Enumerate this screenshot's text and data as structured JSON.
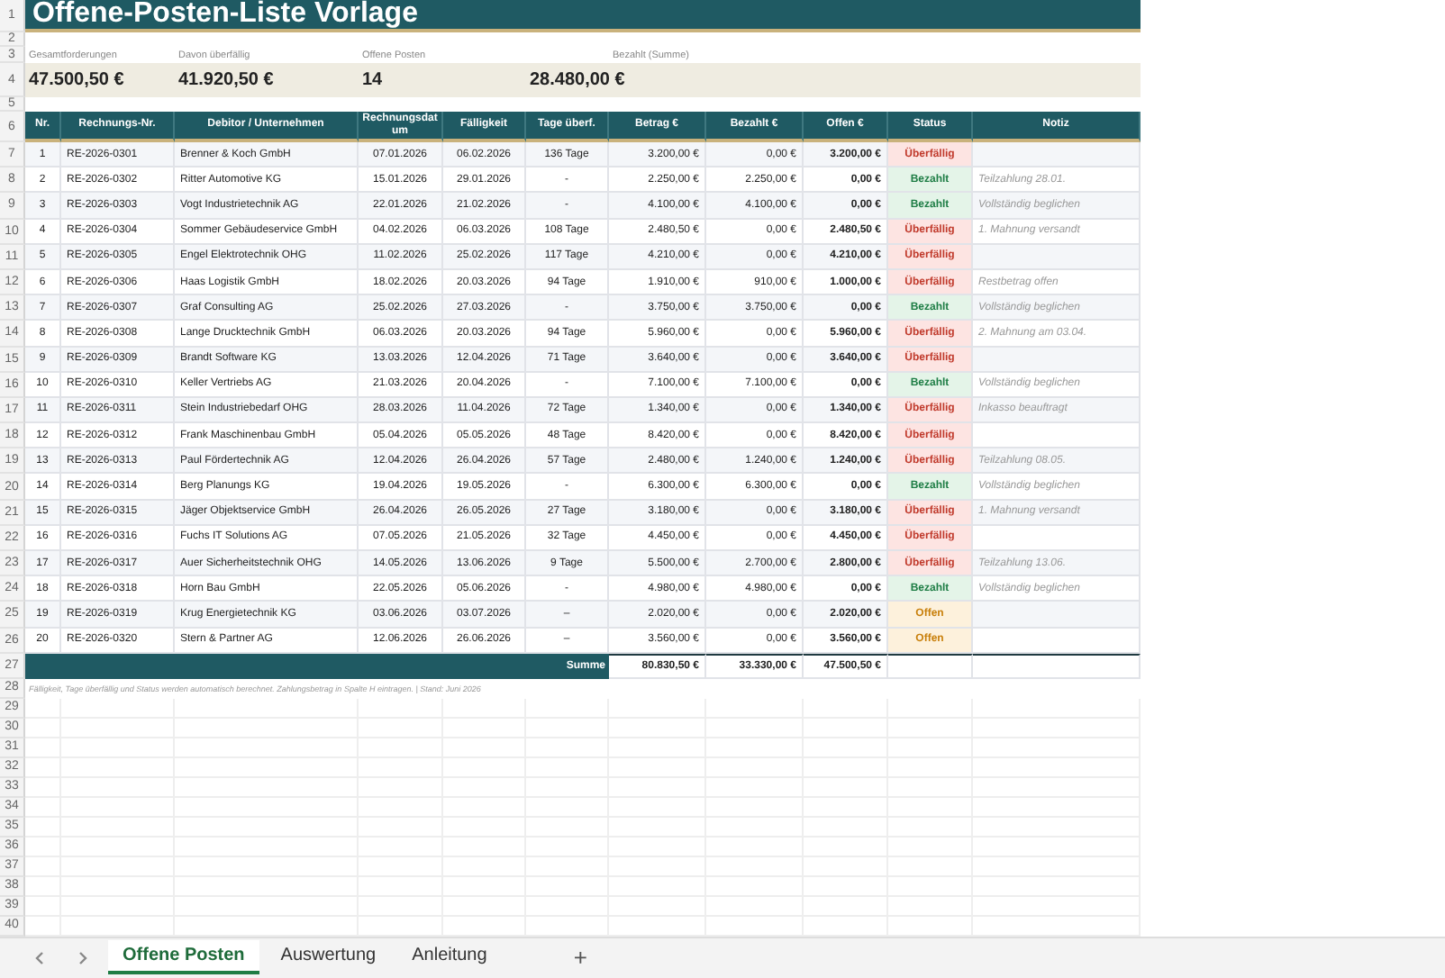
{
  "title": "Offene-Posten-Liste Vorlage",
  "row_numbers": [
    "1",
    "2",
    "3",
    "4",
    "5",
    "6",
    "7",
    "8",
    "9",
    "10",
    "11",
    "12",
    "13",
    "14",
    "15",
    "16",
    "17",
    "18",
    "19",
    "20",
    "21",
    "22",
    "23",
    "24",
    "25",
    "26",
    "27",
    "28",
    "29",
    "30",
    "31",
    "32",
    "33",
    "34",
    "35",
    "36",
    "37",
    "38",
    "39",
    "40"
  ],
  "summary": [
    {
      "label": "Gesamtforderungen",
      "value": "47.500,50 €"
    },
    {
      "label": "Davon überfällig",
      "value": "41.920,50 €"
    },
    {
      "label": "Offene Posten",
      "value": "14"
    },
    {
      "label": "Bezahlt (Summe)",
      "value": "28.480,00 €"
    }
  ],
  "columns": [
    "Nr.",
    "Rechnungs-Nr.",
    "Debitor / Unternehmen",
    "Rechnungsdatum",
    "Fälligkeit",
    "Tage überf.",
    "Betrag €",
    "Bezahlt €",
    "Offen €",
    "Status",
    "Notiz"
  ],
  "rows": [
    {
      "nr": "1",
      "invoice": "RE-2026-0301",
      "debtor": "Brenner & Koch GmbH",
      "date": "07.01.2026",
      "due": "06.02.2026",
      "overdue": "136 Tage",
      "amount": "3.200,00 €",
      "paid": "0,00 €",
      "open": "3.200,00 €",
      "status": "Überfällig",
      "kind": "overdue"
    },
    {
      "nr": "2",
      "invoice": "RE-2026-0302",
      "debtor": "Ritter Automotive KG",
      "date": "15.01.2026",
      "due": "29.01.2026",
      "overdue": "-",
      "amount": "2.250,00 €",
      "paid": "2.250,00 €",
      "open": "0,00 €",
      "status": "Bezahlt",
      "kind": "paid",
      "note": "Teilzahlung 28.01."
    },
    {
      "nr": "3",
      "invoice": "RE-2026-0303",
      "debtor": "Vogt Industrietechnik AG",
      "date": "22.01.2026",
      "due": "21.02.2026",
      "overdue": "-",
      "amount": "4.100,00 €",
      "paid": "4.100,00 €",
      "open": "0,00 €",
      "status": "Bezahlt",
      "kind": "paid",
      "note": "Vollständig beglichen"
    },
    {
      "nr": "4",
      "invoice": "RE-2026-0304",
      "debtor": "Sommer Gebäudeservice GmbH",
      "date": "04.02.2026",
      "due": "06.03.2026",
      "overdue": "108 Tage",
      "amount": "2.480,50 €",
      "paid": "0,00 €",
      "open": "2.480,50 €",
      "status": "Überfällig",
      "kind": "overdue",
      "note": "1. Mahnung versandt"
    },
    {
      "nr": "5",
      "invoice": "RE-2026-0305",
      "debtor": "Engel Elektrotechnik OHG",
      "date": "11.02.2026",
      "due": "25.02.2026",
      "overdue": "117 Tage",
      "amount": "4.210,00 €",
      "paid": "0,00 €",
      "open": "4.210,00 €",
      "status": "Überfällig",
      "kind": "overdue"
    },
    {
      "nr": "6",
      "invoice": "RE-2026-0306",
      "debtor": "Haas Logistik GmbH",
      "date": "18.02.2026",
      "due": "20.03.2026",
      "overdue": "94 Tage",
      "amount": "1.910,00 €",
      "paid": "910,00 €",
      "open": "1.000,00 €",
      "status": "Überfällig",
      "kind": "overdue",
      "note": "Restbetrag offen"
    },
    {
      "nr": "7",
      "invoice": "RE-2026-0307",
      "debtor": "Graf Consulting AG",
      "date": "25.02.2026",
      "due": "27.03.2026",
      "overdue": "-",
      "amount": "3.750,00 €",
      "paid": "3.750,00 €",
      "open": "0,00 €",
      "status": "Bezahlt",
      "kind": "paid",
      "note": "Vollständig beglichen"
    },
    {
      "nr": "8",
      "invoice": "RE-2026-0308",
      "debtor": "Lange Drucktechnik GmbH",
      "date": "06.03.2026",
      "due": "20.03.2026",
      "overdue": "94 Tage",
      "amount": "5.960,00 €",
      "paid": "0,00 €",
      "open": "5.960,00 €",
      "status": "Überfällig",
      "kind": "overdue",
      "note": "2. Mahnung am 03.04."
    },
    {
      "nr": "9",
      "invoice": "RE-2026-0309",
      "debtor": "Brandt Software KG",
      "date": "13.03.2026",
      "due": "12.04.2026",
      "overdue": "71 Tage",
      "amount": "3.640,00 €",
      "paid": "0,00 €",
      "open": "3.640,00 €",
      "status": "Überfällig",
      "kind": "overdue"
    },
    {
      "nr": "10",
      "invoice": "RE-2026-0310",
      "debtor": "Keller Vertriebs AG",
      "date": "21.03.2026",
      "due": "20.04.2026",
      "overdue": "-",
      "amount": "7.100,00 €",
      "paid": "7.100,00 €",
      "open": "0,00 €",
      "status": "Bezahlt",
      "kind": "paid",
      "note": "Vollständig beglichen"
    },
    {
      "nr": "11",
      "invoice": "RE-2026-0311",
      "debtor": "Stein Industriebedarf OHG",
      "date": "28.03.2026",
      "due": "11.04.2026",
      "overdue": "72 Tage",
      "amount": "1.340,00 €",
      "paid": "0,00 €",
      "open": "1.340,00 €",
      "status": "Überfällig",
      "kind": "overdue",
      "note": "Inkasso beauftragt"
    },
    {
      "nr": "12",
      "invoice": "RE-2026-0312",
      "debtor": "Frank Maschinenbau GmbH",
      "date": "05.04.2026",
      "due": "05.05.2026",
      "overdue": "48 Tage",
      "amount": "8.420,00 €",
      "paid": "0,00 €",
      "open": "8.420,00 €",
      "status": "Überfällig",
      "kind": "overdue"
    },
    {
      "nr": "13",
      "invoice": "RE-2026-0313",
      "debtor": "Paul Fördertechnik AG",
      "date": "12.04.2026",
      "due": "26.04.2026",
      "overdue": "57 Tage",
      "amount": "2.480,00 €",
      "paid": "1.240,00 €",
      "open": "1.240,00 €",
      "status": "Überfällig",
      "kind": "overdue",
      "note": "Teilzahlung 08.05."
    },
    {
      "nr": "14",
      "invoice": "RE-2026-0314",
      "debtor": "Berg Planungs KG",
      "date": "19.04.2026",
      "due": "19.05.2026",
      "overdue": "-",
      "amount": "6.300,00 €",
      "paid": "6.300,00 €",
      "open": "0,00 €",
      "status": "Bezahlt",
      "kind": "paid",
      "note": "Vollständig beglichen"
    },
    {
      "nr": "15",
      "invoice": "RE-2026-0315",
      "debtor": "Jäger Objektservice GmbH",
      "date": "26.04.2026",
      "due": "26.05.2026",
      "overdue": "27 Tage",
      "amount": "3.180,00 €",
      "paid": "0,00 €",
      "open": "3.180,00 €",
      "status": "Überfällig",
      "kind": "overdue",
      "note": "1. Mahnung versandt"
    },
    {
      "nr": "16",
      "invoice": "RE-2026-0316",
      "debtor": "Fuchs IT Solutions AG",
      "date": "07.05.2026",
      "due": "21.05.2026",
      "overdue": "32 Tage",
      "amount": "4.450,00 €",
      "paid": "0,00 €",
      "open": "4.450,00 €",
      "status": "Überfällig",
      "kind": "overdue"
    },
    {
      "nr": "17",
      "invoice": "RE-2026-0317",
      "debtor": "Auer Sicherheitstechnik OHG",
      "date": "14.05.2026",
      "due": "13.06.2026",
      "overdue": "9 Tage",
      "amount": "5.500,00 €",
      "paid": "2.700,00 €",
      "open": "2.800,00 €",
      "status": "Überfällig",
      "kind": "overdue",
      "note": "Teilzahlung 13.06."
    },
    {
      "nr": "18",
      "invoice": "RE-2026-0318",
      "debtor": "Horn Bau GmbH",
      "date": "22.05.2026",
      "due": "05.06.2026",
      "overdue": "-",
      "amount": "4.980,00 €",
      "paid": "4.980,00 €",
      "open": "0,00 €",
      "status": "Bezahlt",
      "kind": "paid",
      "note": "Vollständig beglichen"
    },
    {
      "nr": "19",
      "invoice": "RE-2026-0319",
      "debtor": "Krug Energietechnik KG",
      "date": "03.06.2026",
      "due": "03.07.2026",
      "overdue": "–",
      "amount": "2.020,00 €",
      "paid": "0,00 €",
      "open": "2.020,00 €",
      "status": "Offen",
      "kind": "open"
    },
    {
      "nr": "20",
      "invoice": "RE-2026-0320",
      "debtor": "Stern & Partner AG",
      "date": "12.06.2026",
      "due": "26.06.2026",
      "overdue": "–",
      "amount": "3.560,00 €",
      "paid": "0,00 €",
      "open": "3.560,00 €",
      "status": "Offen",
      "kind": "open"
    }
  ],
  "totals": {
    "label": "Summe",
    "amount": "80.830,50 €",
    "paid": "33.330,00 €",
    "open": "47.500,50 €"
  },
  "footnote": "Fälligkeit, Tage überfällig und Status werden automatisch berechnet.  Zahlungsbetrag in Spalte H eintragen.  |  Stand: Juni 2026",
  "sheet_tabs": [
    {
      "label": "Offene Posten",
      "selected": true
    },
    {
      "label": "Auswertung",
      "selected": false
    },
    {
      "label": "Anleitung",
      "selected": false
    }
  ],
  "add_sheet": "+"
}
